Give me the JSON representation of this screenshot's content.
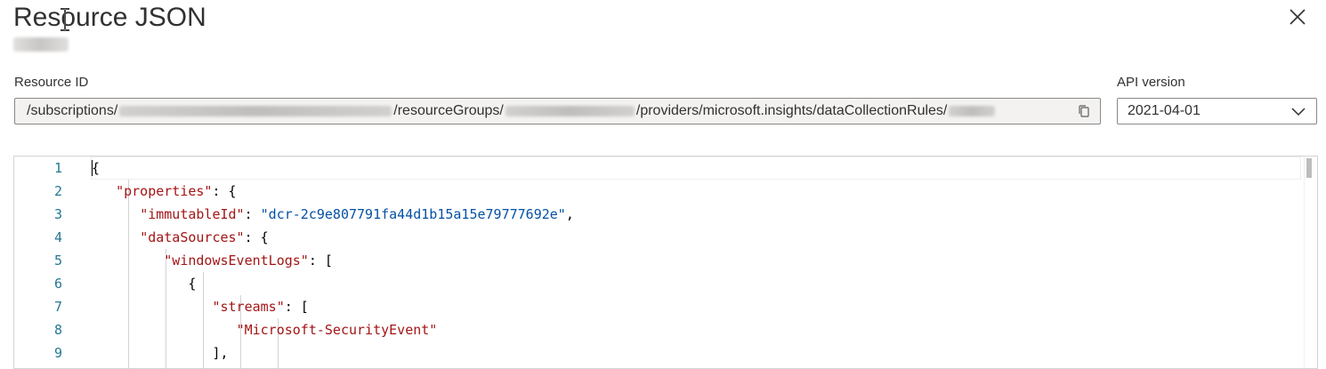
{
  "header": {
    "title": "Resource JSON"
  },
  "resource_id": {
    "label": "Resource ID",
    "segments": [
      "/subscriptions/",
      "/resourceGroups/",
      "/providers/microsoft.insights/dataCollectionRules/"
    ]
  },
  "api_version": {
    "label": "API version",
    "selected": "2021-04-01"
  },
  "editor": {
    "line_numbers": [
      "1",
      "2",
      "3",
      "4",
      "5",
      "6",
      "7",
      "8",
      "9"
    ],
    "lines": {
      "l1_open": "{",
      "l2_key": "\"properties\"",
      "l2_rest": ": {",
      "l3_key": "\"immutableId\"",
      "l3_sep": ": ",
      "l3_val": "\"dcr-2c9e807791fa44d1b15a15e79777692e\"",
      "l3_end": ",",
      "l4_key": "\"dataSources\"",
      "l4_rest": ": {",
      "l5_key": "\"windowsEventLogs\"",
      "l5_rest": ": [",
      "l6_open": "{",
      "l7_key": "\"streams\"",
      "l7_rest": ": [",
      "l8_val": "\"Microsoft-SecurityEvent\"",
      "l9_close": "],"
    }
  },
  "colors": {
    "json_key": "#a31515",
    "json_string": "#0451a5",
    "line_number": "#237893"
  },
  "icons": {
    "close": "close-icon",
    "copy": "copy-icon",
    "dropdown": "chevron-down-icon",
    "text_cursor": "i-beam-cursor-icon"
  }
}
